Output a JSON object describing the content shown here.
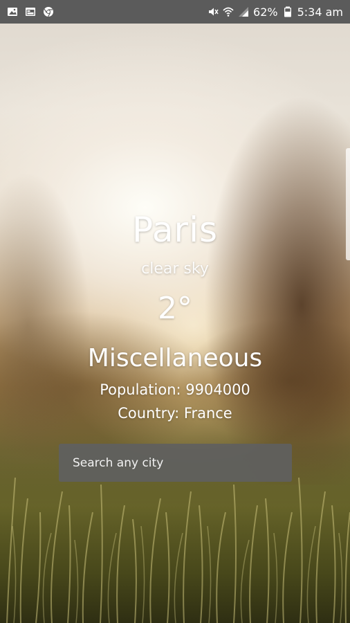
{
  "status_bar": {
    "battery": "62%",
    "time": "5:34 am",
    "left_icons": [
      "image-icon",
      "window-icon",
      "chrome-icon"
    ],
    "right_icons": [
      "mute-icon",
      "wifi-icon",
      "signal-icon",
      "battery-icon"
    ]
  },
  "weather": {
    "city": "Paris",
    "condition": "clear sky",
    "temperature": "2°",
    "category": "Miscellaneous",
    "population": "Population: 9904000",
    "country": "Country: France"
  },
  "search": {
    "placeholder": "Search any city",
    "value": ""
  },
  "colors": {
    "status_bar": "#5b5b5b",
    "search_box": "#5f5f5f",
    "text": "#ffffff"
  }
}
